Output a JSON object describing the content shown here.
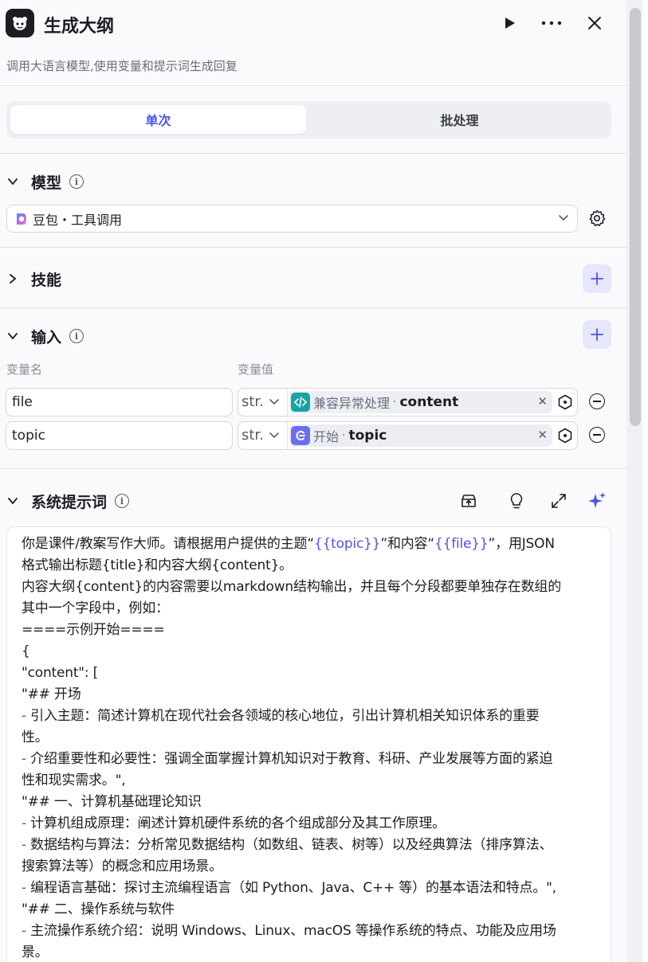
{
  "header": {
    "title": "生成大纲",
    "description": "调用大语言模型,使用变量和提示词生成回复"
  },
  "tabs": [
    {
      "label": "单次",
      "active": true
    },
    {
      "label": "批处理",
      "active": false
    }
  ],
  "model_section": {
    "label": "模型",
    "selected_model": "豆包・工具调用"
  },
  "skills_section": {
    "label": "技能"
  },
  "input_section": {
    "label": "输入",
    "col_name": "变量名",
    "col_value": "变量值",
    "rows": [
      {
        "name": "file",
        "type": "str.",
        "ref_node": "兼容异常处理",
        "ref_var": "content"
      },
      {
        "name": "topic",
        "type": "str.",
        "ref_node": "开始",
        "ref_var": "topic"
      }
    ]
  },
  "prompt_section": {
    "label": "系统提示词",
    "lines": {
      "l1a": "你是课件/教案写作大师。请根据用户提供的主题“",
      "l1v1": "{{topic}}",
      "l1b": "”和内容“",
      "l1v2": "{{file}}",
      "l1c": "”，用JSON",
      "l2": "格式输出标题{title}和内容大纲{content}。",
      "l3": "内容大纲{content}的内容需要以markdown结构输出，并且每个分段都要单独存在数组的",
      "l4": "其中一个字段中，例如：",
      "l5": "====示例开始====",
      "l6": "{",
      "l7": "\"content\": [",
      "l8": "\"## 开场",
      "l9": " 引入主题：简述计算机在现代社会各领域的核心地位，引出计算机相关知识体系的重要",
      "l10": "性。",
      "l11": " 介绍重要性和必要性：强调全面掌握计算机知识对于教育、科研、产业发展等方面的紧迫",
      "l12": "性和现实需求。\",",
      "l13": "\"## 一、计算机基础理论知识",
      "l14": " 计算机组成原理：阐述计算机硬件系统的各个组成部分及其工作原理。",
      "l15": " 数据结构与算法：分析常见数据结构（如数组、链表、树等）以及经典算法（排序算法、",
      "l16": "搜索算法等）的概念和应用场景。",
      "l17": " 编程语言基础：探讨主流编程语言（如 Python、Java、C++ 等）的基本语法和特点。\",",
      "l18": "\"## 二、操作系统与软件",
      "l19": " 主流操作系统介绍：说明 Windows、Linux、macOS 等操作系统的特点、功能及应用场",
      "l20": "景。",
      "dash": "-"
    }
  },
  "colors": {
    "accent": "#4d53e8",
    "code_node": "#16a3a3",
    "start_node": "#6a6ef0"
  }
}
